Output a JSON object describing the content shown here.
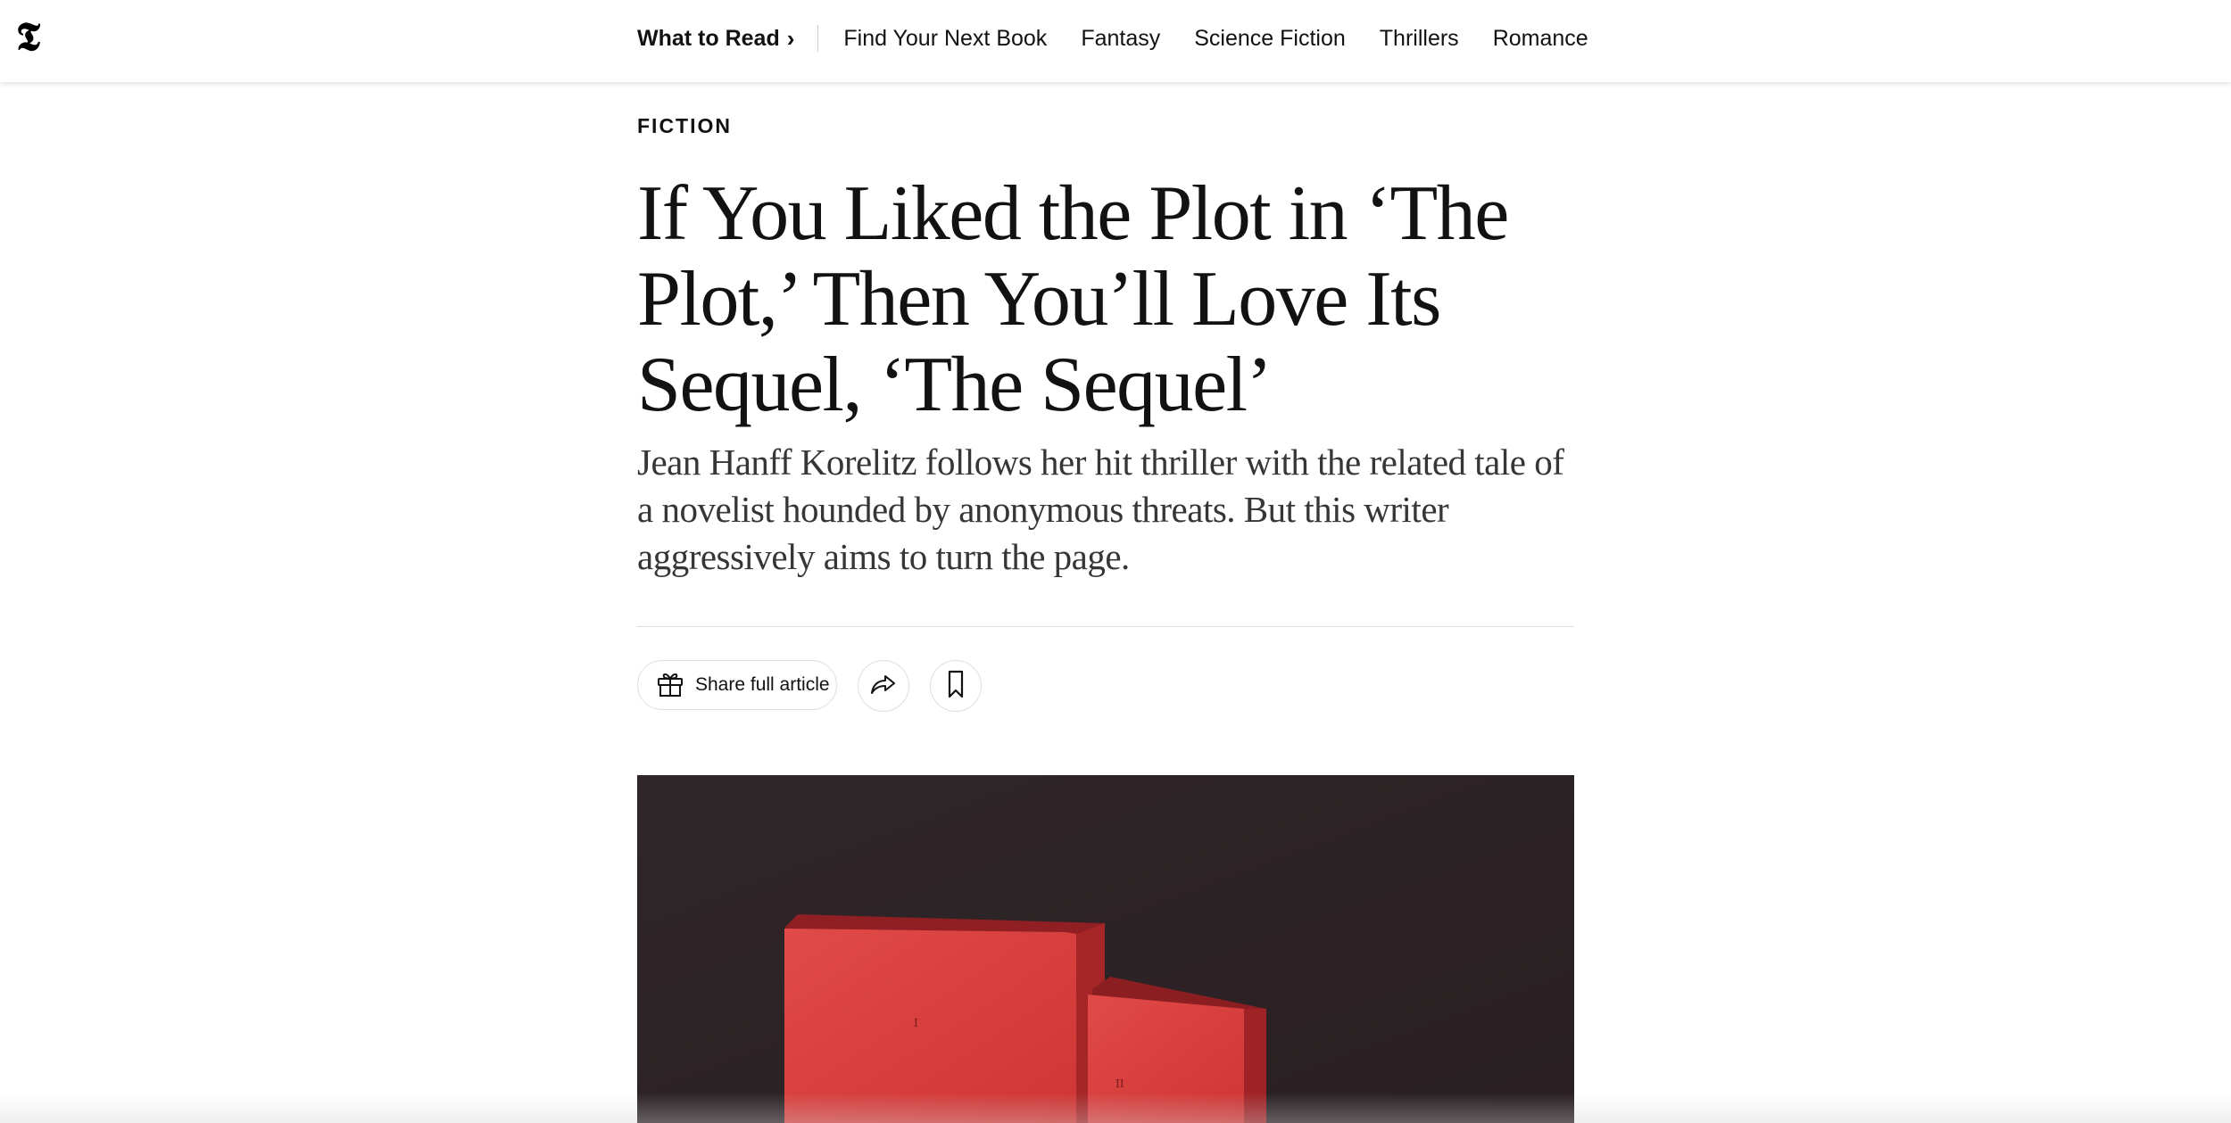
{
  "header": {
    "logo_icon": "nyt-t-logo-icon",
    "section_label": "What to Read",
    "section_chevron": "›",
    "nav_links": [
      "Find Your Next Book",
      "Fantasy",
      "Science Fiction",
      "Thrillers",
      "Romance"
    ]
  },
  "article": {
    "kicker": "FICTION",
    "headline": "If You Liked the Plot in ‘The Plot,’ Then You’ll Love Its Sequel, ‘The Sequel’",
    "summary": "Jean Hanff Korelitz follows her hit thriller with the related tale of a novelist hounded by anonymous threats. But this writer aggressively aims to turn the page."
  },
  "actions": {
    "share_label": "Share full article",
    "share_icon": "gift-icon",
    "forward_icon": "share-arrow-icon",
    "save_icon": "bookmark-icon"
  },
  "hero_image": {
    "book_large_mark": "I",
    "book_small_mark": "II"
  },
  "colors": {
    "text": "#121212",
    "summary_text": "#363636",
    "image_background": "#2f2528",
    "book_red": "#d93a3a"
  }
}
